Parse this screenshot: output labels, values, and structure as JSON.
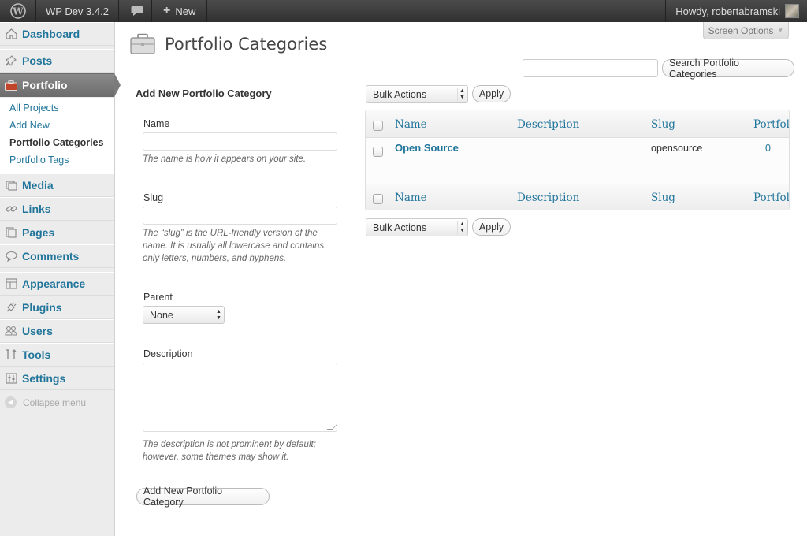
{
  "adminbar": {
    "site_name": "WP Dev 3.4.2",
    "new_label": "New",
    "howdy": "Howdy, robertabramski"
  },
  "sidebar": {
    "items": [
      {
        "label": "Dashboard",
        "icon": "dashboard-icon"
      },
      {
        "label": "Posts",
        "icon": "pin-icon"
      },
      {
        "label": "Portfolio",
        "icon": "briefcase-icon"
      },
      {
        "label": "Media",
        "icon": "media-icon"
      },
      {
        "label": "Links",
        "icon": "link-icon"
      },
      {
        "label": "Pages",
        "icon": "pages-icon"
      },
      {
        "label": "Comments",
        "icon": "comment-icon"
      },
      {
        "label": "Appearance",
        "icon": "appearance-icon"
      },
      {
        "label": "Plugins",
        "icon": "plug-icon"
      },
      {
        "label": "Users",
        "icon": "users-icon"
      },
      {
        "label": "Tools",
        "icon": "tools-icon"
      },
      {
        "label": "Settings",
        "icon": "settings-icon"
      }
    ],
    "submenu": [
      "All Projects",
      "Add New",
      "Portfolio Categories",
      "Portfolio Tags"
    ],
    "collapse": "Collapse menu"
  },
  "header": {
    "title": "Portfolio Categories",
    "screen_options": "Screen Options"
  },
  "search": {
    "button": "Search Portfolio Categories",
    "value": ""
  },
  "form": {
    "heading": "Add New Portfolio Category",
    "name_label": "Name",
    "name_desc": "The name is how it appears on your site.",
    "slug_label": "Slug",
    "slug_desc": "The “slug” is the URL-friendly version of the name. It is usually all lowercase and contains only letters, numbers, and hyphens.",
    "parent_label": "Parent",
    "parent_value": "None",
    "description_label": "Description",
    "description_desc": "The description is not prominent by default; however, some themes may show it.",
    "submit": "Add New Portfolio Category"
  },
  "list": {
    "bulk_actions": "Bulk Actions",
    "apply": "Apply",
    "columns": [
      "Name",
      "Description",
      "Slug",
      "Portfolio"
    ],
    "rows": [
      {
        "name": "Open Source",
        "description": "",
        "slug": "opensource",
        "count": "0"
      }
    ]
  },
  "colors": {
    "link": "#21759b",
    "admin_bar": "#464646",
    "current_menu": "#7b7b7b"
  }
}
